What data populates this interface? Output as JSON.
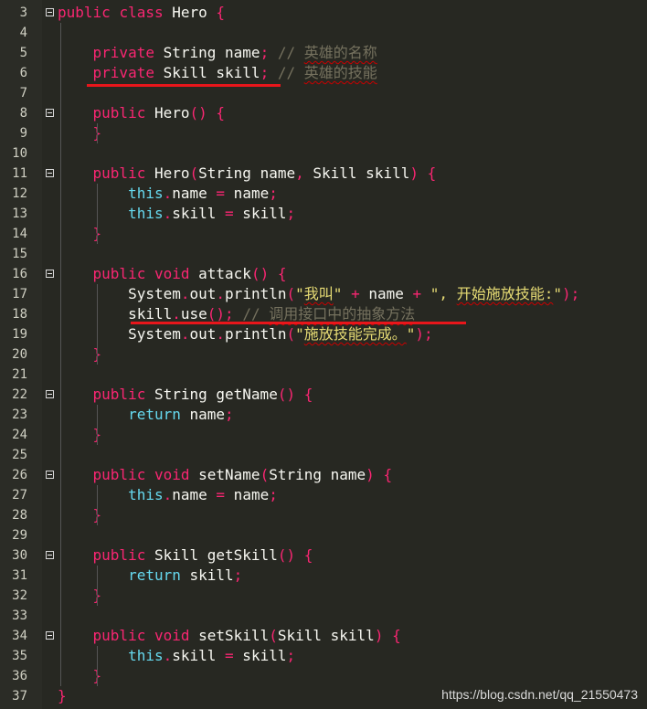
{
  "editor": {
    "lines": [
      {
        "n": "3",
        "tokens": [
          [
            "kw",
            "public"
          ],
          [
            "plain",
            " "
          ],
          [
            "kw",
            "class"
          ],
          [
            "plain",
            " Hero "
          ],
          [
            "pu",
            "{"
          ]
        ]
      },
      {
        "n": "4",
        "tokens": []
      },
      {
        "n": "5",
        "tokens": [
          [
            "plain",
            "    "
          ],
          [
            "kw",
            "private"
          ],
          [
            "plain",
            " String name"
          ],
          [
            "pu",
            ";"
          ],
          [
            "plain",
            " "
          ],
          [
            "cm",
            "// 英雄的名称"
          ]
        ]
      },
      {
        "n": "6",
        "tokens": [
          [
            "plain",
            "    "
          ],
          [
            "kw",
            "private"
          ],
          [
            "plain",
            " Skill skill"
          ],
          [
            "pu",
            ";"
          ],
          [
            "plain",
            " "
          ],
          [
            "cm",
            "// 英雄的技能"
          ]
        ]
      },
      {
        "n": "7",
        "tokens": []
      },
      {
        "n": "8",
        "tokens": [
          [
            "plain",
            "    "
          ],
          [
            "kw",
            "public"
          ],
          [
            "plain",
            " Hero"
          ],
          [
            "pu",
            "() {"
          ]
        ]
      },
      {
        "n": "9",
        "tokens": [
          [
            "plain",
            "    "
          ],
          [
            "pu",
            "}"
          ]
        ]
      },
      {
        "n": "10",
        "tokens": []
      },
      {
        "n": "11",
        "tokens": [
          [
            "plain",
            "    "
          ],
          [
            "kw",
            "public"
          ],
          [
            "plain",
            " Hero"
          ],
          [
            "pu",
            "("
          ],
          [
            "plain",
            "String name"
          ],
          [
            "pu",
            ","
          ],
          [
            "plain",
            " Skill skill"
          ],
          [
            "pu",
            ") {"
          ]
        ]
      },
      {
        "n": "12",
        "tokens": [
          [
            "plain",
            "        "
          ],
          [
            "th",
            "this"
          ],
          [
            "pu",
            "."
          ],
          [
            "plain",
            "name "
          ],
          [
            "pu",
            "="
          ],
          [
            "plain",
            " name"
          ],
          [
            "pu",
            ";"
          ]
        ]
      },
      {
        "n": "13",
        "tokens": [
          [
            "plain",
            "        "
          ],
          [
            "th",
            "this"
          ],
          [
            "pu",
            "."
          ],
          [
            "plain",
            "skill "
          ],
          [
            "pu",
            "="
          ],
          [
            "plain",
            " skill"
          ],
          [
            "pu",
            ";"
          ]
        ]
      },
      {
        "n": "14",
        "tokens": [
          [
            "plain",
            "    "
          ],
          [
            "pu",
            "}"
          ]
        ]
      },
      {
        "n": "15",
        "tokens": []
      },
      {
        "n": "16",
        "tokens": [
          [
            "plain",
            "    "
          ],
          [
            "kw",
            "public"
          ],
          [
            "plain",
            " "
          ],
          [
            "kw",
            "void"
          ],
          [
            "plain",
            " attack"
          ],
          [
            "pu",
            "() {"
          ]
        ]
      },
      {
        "n": "17",
        "tokens": [
          [
            "plain",
            "        System"
          ],
          [
            "pu",
            "."
          ],
          [
            "plain",
            "out"
          ],
          [
            "pu",
            "."
          ],
          [
            "plain",
            "println"
          ],
          [
            "pu",
            "("
          ],
          [
            "st",
            "\"我叫\""
          ],
          [
            "plain",
            " "
          ],
          [
            "pu",
            "+"
          ],
          [
            "plain",
            " name "
          ],
          [
            "pu",
            "+"
          ],
          [
            "plain",
            " "
          ],
          [
            "st",
            "\", 开始施放技能:\""
          ],
          [
            "pu",
            ");"
          ]
        ]
      },
      {
        "n": "18",
        "tokens": [
          [
            "plain",
            "        skill"
          ],
          [
            "pu",
            "."
          ],
          [
            "plain",
            "use"
          ],
          [
            "pu",
            "();"
          ],
          [
            "plain",
            " "
          ],
          [
            "cm",
            "// 调用接口中的抽象方法"
          ]
        ]
      },
      {
        "n": "19",
        "tokens": [
          [
            "plain",
            "        System"
          ],
          [
            "pu",
            "."
          ],
          [
            "plain",
            "out"
          ],
          [
            "pu",
            "."
          ],
          [
            "plain",
            "println"
          ],
          [
            "pu",
            "("
          ],
          [
            "st",
            "\"施放技能完成。\""
          ],
          [
            "pu",
            ");"
          ]
        ]
      },
      {
        "n": "20",
        "tokens": [
          [
            "plain",
            "    "
          ],
          [
            "pu",
            "}"
          ]
        ]
      },
      {
        "n": "21",
        "tokens": []
      },
      {
        "n": "22",
        "tokens": [
          [
            "plain",
            "    "
          ],
          [
            "kw",
            "public"
          ],
          [
            "plain",
            " String getName"
          ],
          [
            "pu",
            "() {"
          ]
        ]
      },
      {
        "n": "23",
        "tokens": [
          [
            "plain",
            "        "
          ],
          [
            "th",
            "return"
          ],
          [
            "plain",
            " name"
          ],
          [
            "pu",
            ";"
          ]
        ]
      },
      {
        "n": "24",
        "tokens": [
          [
            "plain",
            "    "
          ],
          [
            "pu",
            "}"
          ]
        ]
      },
      {
        "n": "25",
        "tokens": []
      },
      {
        "n": "26",
        "tokens": [
          [
            "plain",
            "    "
          ],
          [
            "kw",
            "public"
          ],
          [
            "plain",
            " "
          ],
          [
            "kw",
            "void"
          ],
          [
            "plain",
            " setName"
          ],
          [
            "pu",
            "("
          ],
          [
            "plain",
            "String name"
          ],
          [
            "pu",
            ") {"
          ]
        ]
      },
      {
        "n": "27",
        "tokens": [
          [
            "plain",
            "        "
          ],
          [
            "th",
            "this"
          ],
          [
            "pu",
            "."
          ],
          [
            "plain",
            "name "
          ],
          [
            "pu",
            "="
          ],
          [
            "plain",
            " name"
          ],
          [
            "pu",
            ";"
          ]
        ]
      },
      {
        "n": "28",
        "tokens": [
          [
            "plain",
            "    "
          ],
          [
            "pu",
            "}"
          ]
        ]
      },
      {
        "n": "29",
        "tokens": []
      },
      {
        "n": "30",
        "tokens": [
          [
            "plain",
            "    "
          ],
          [
            "kw",
            "public"
          ],
          [
            "plain",
            " Skill getSkill"
          ],
          [
            "pu",
            "() {"
          ]
        ]
      },
      {
        "n": "31",
        "tokens": [
          [
            "plain",
            "        "
          ],
          [
            "th",
            "return"
          ],
          [
            "plain",
            " skill"
          ],
          [
            "pu",
            ";"
          ]
        ]
      },
      {
        "n": "32",
        "tokens": [
          [
            "plain",
            "    "
          ],
          [
            "pu",
            "}"
          ]
        ]
      },
      {
        "n": "33",
        "tokens": []
      },
      {
        "n": "34",
        "tokens": [
          [
            "plain",
            "    "
          ],
          [
            "kw",
            "public"
          ],
          [
            "plain",
            " "
          ],
          [
            "kw",
            "void"
          ],
          [
            "plain",
            " setSkill"
          ],
          [
            "pu",
            "("
          ],
          [
            "plain",
            "Skill skill"
          ],
          [
            "pu",
            ") {"
          ]
        ]
      },
      {
        "n": "35",
        "tokens": [
          [
            "plain",
            "        "
          ],
          [
            "th",
            "this"
          ],
          [
            "pu",
            "."
          ],
          [
            "plain",
            "skill "
          ],
          [
            "pu",
            "="
          ],
          [
            "plain",
            " skill"
          ],
          [
            "pu",
            ";"
          ]
        ]
      },
      {
        "n": "36",
        "tokens": [
          [
            "plain",
            "    "
          ],
          [
            "pu",
            "}"
          ]
        ]
      },
      {
        "n": "37",
        "tokens": [
          [
            "pu",
            "}"
          ]
        ]
      }
    ],
    "fold_lines": [
      "3",
      "8",
      "11",
      "16",
      "22",
      "26",
      "30",
      "34"
    ]
  },
  "watermark": "https://blog.csdn.net/qq_21550473",
  "colors": {
    "background": "#272822",
    "keyword": "#f92672",
    "this_return": "#66d9ef",
    "string": "#e6db74",
    "comment": "#75715e",
    "annotation_line": "#e8161b"
  }
}
